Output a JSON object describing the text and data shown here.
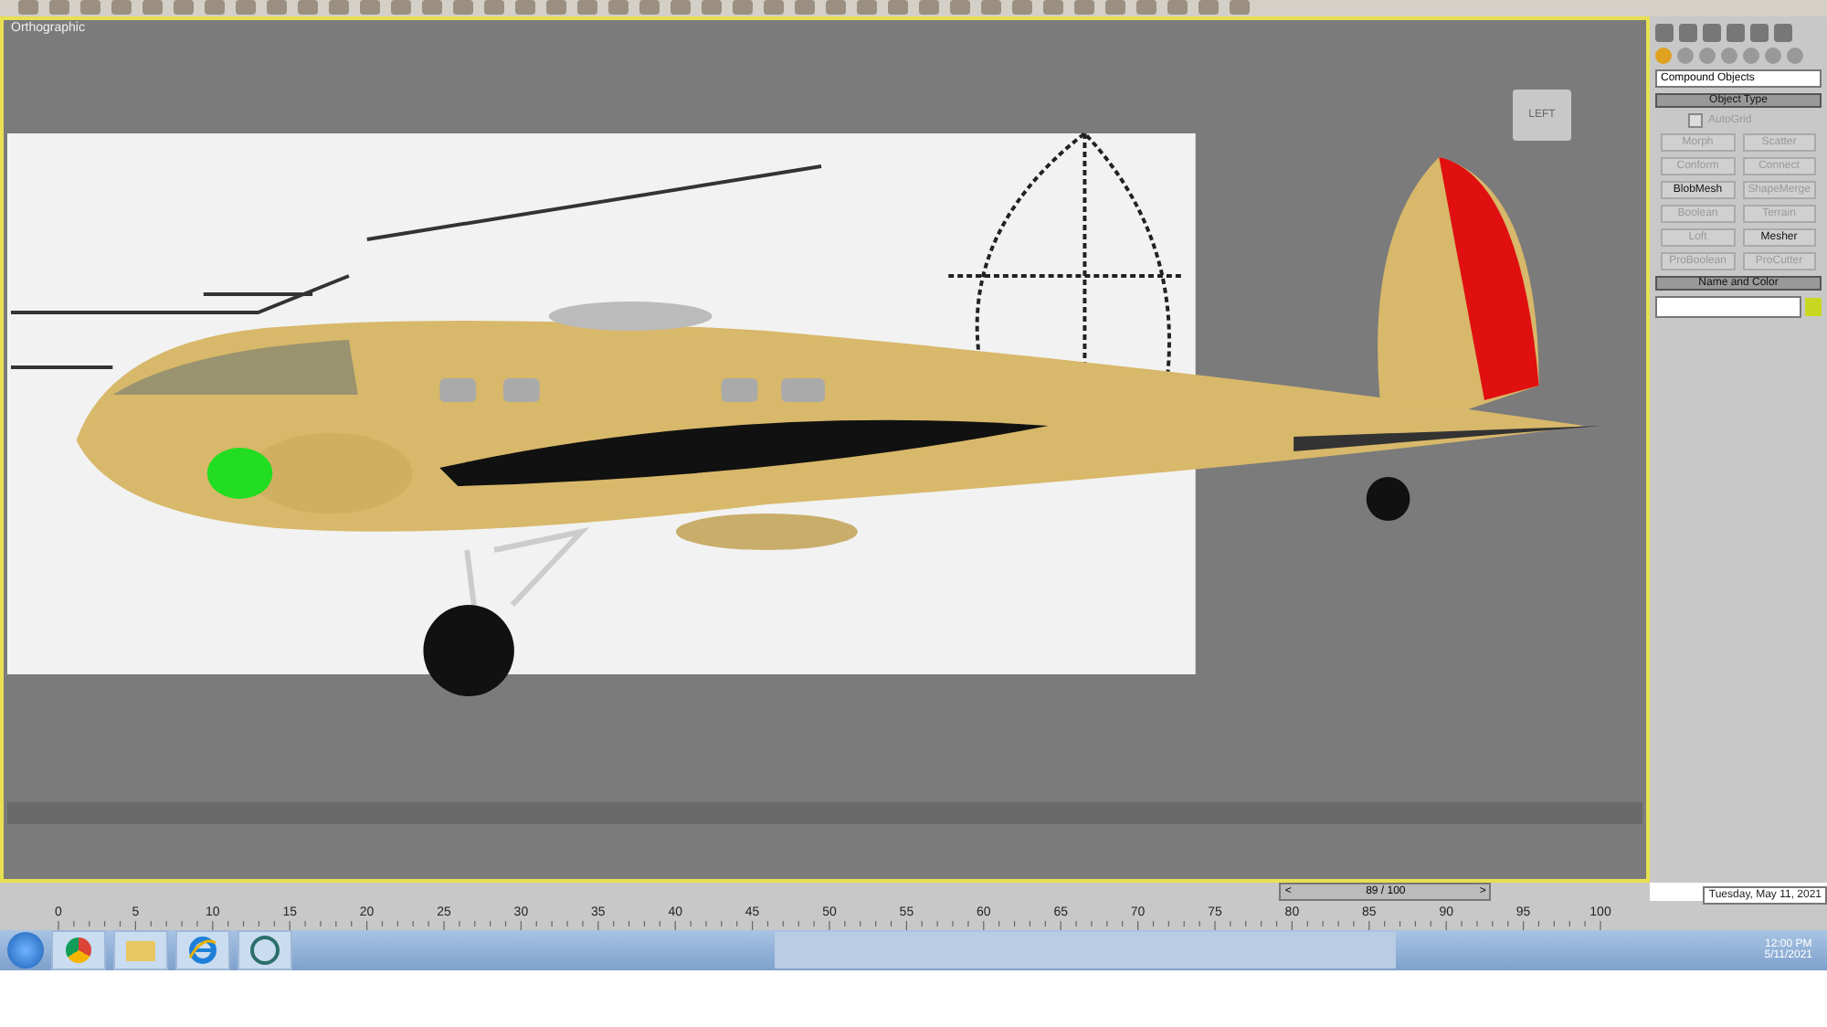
{
  "viewport": {
    "label": "Orthographic",
    "viewcube_face": "LEFT"
  },
  "command_panel": {
    "dropdown": "Compound Objects",
    "object_type": {
      "title": "Object Type",
      "autogrid": {
        "label": "AutoGrid",
        "checked": false,
        "disabled": true
      },
      "buttons": [
        {
          "label": "Morph",
          "disabled": true
        },
        {
          "label": "Scatter",
          "disabled": true
        },
        {
          "label": "Conform",
          "disabled": true
        },
        {
          "label": "Connect",
          "disabled": true
        },
        {
          "label": "BlobMesh",
          "disabled": false
        },
        {
          "label": "ShapeMerge",
          "disabled": true
        },
        {
          "label": "Boolean",
          "disabled": true
        },
        {
          "label": "Terrain",
          "disabled": true
        },
        {
          "label": "Loft",
          "disabled": true
        },
        {
          "label": "Mesher",
          "disabled": false
        },
        {
          "label": "ProBoolean",
          "disabled": true
        },
        {
          "label": "ProCutter",
          "disabled": true
        }
      ]
    },
    "name_and_color": {
      "title": "Name and Color",
      "color": "#c8d820"
    }
  },
  "time_slider": {
    "frame": "89 / 100",
    "level": 0.89,
    "prev": "<",
    "next": ">"
  },
  "timeline": {
    "ticks": [
      "0",
      "5",
      "10",
      "15",
      "20",
      "25",
      "30",
      "35",
      "40",
      "45",
      "50",
      "55",
      "60",
      "65",
      "70",
      "75",
      "80",
      "85",
      "90",
      "95",
      "100"
    ]
  },
  "taskbar": {
    "time": "12:00 PM",
    "date": "5/11/2021",
    "tooltip": "Tuesday, May 11, 2021"
  }
}
